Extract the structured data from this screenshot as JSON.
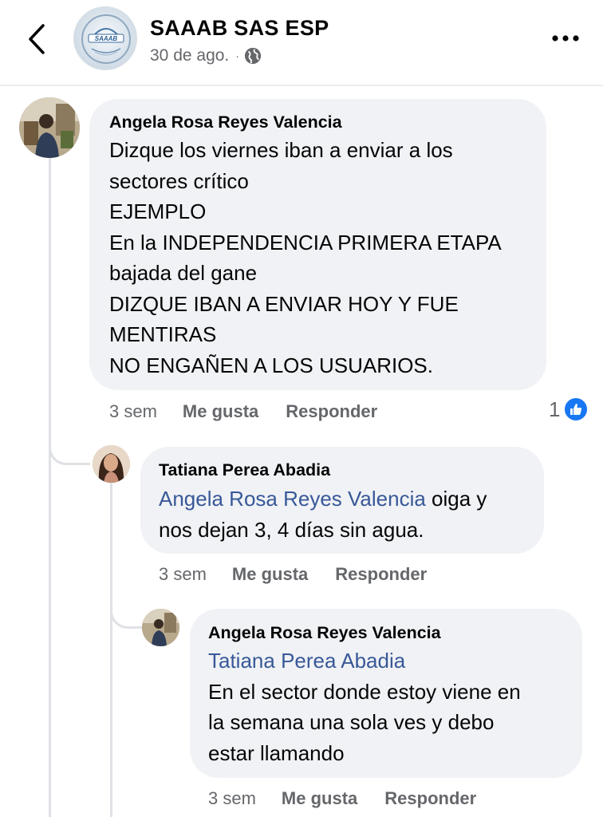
{
  "header": {
    "page_name": "SAAAB SAS ESP",
    "logo_text": "SAAAB",
    "date": "30 de ago.",
    "separator": "·",
    "privacy_icon": "globe-icon",
    "back_icon": "chevron-left-icon",
    "more_icon": "more-horizontal-icon"
  },
  "comments": [
    {
      "author": "Angela Rosa Reyes Valencia",
      "lines": [
        "Dizque los viernes iban a enviar a los",
        "sectores crítico",
        "EJEMPLO",
        "En la INDEPENDENCIA PRIMERA ETAPA",
        "bajada del gane",
        "DIZQUE IBAN A ENVIAR HOY Y FUE",
        "MENTIRAS",
        "NO ENGAÑEN A LOS USUARIOS."
      ],
      "time": "3 sem",
      "like_label": "Me gusta",
      "reply_label": "Responder",
      "reaction_count": "1",
      "reaction_icon": "like-icon"
    },
    {
      "author": "Tatiana Perea Abadia",
      "mention": "Angela Rosa Reyes Valencia",
      "line1_rest": " oiga y",
      "line2": "nos dejan 3, 4 días sin agua.",
      "time": "3 sem",
      "like_label": "Me gusta",
      "reply_label": "Responder"
    },
    {
      "author": "Angela Rosa Reyes Valencia",
      "mention": "Tatiana Perea Abadia",
      "lines": [
        "En el sector donde estoy viene en",
        "la semana una sola ves y debo",
        "estar llamando"
      ],
      "time": "3 sem",
      "like_label": "Me gusta",
      "reply_label": "Responder"
    }
  ],
  "colors": {
    "bubble": "#f0f2f5",
    "mention": "#385898",
    "meta": "#65676b",
    "like_blue": "#1877f2"
  }
}
